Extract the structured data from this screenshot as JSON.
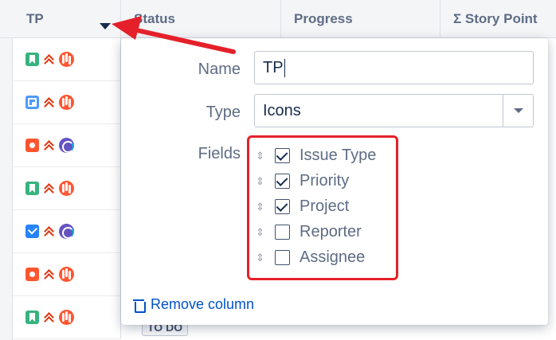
{
  "columns": {
    "tp": "TP",
    "status": "Status",
    "progress": "Progress",
    "story_points": "Σ Story Point"
  },
  "rows": [
    {
      "issue_type": "story-icon",
      "priority": "highest-priority-icon",
      "project": "red-project-icon"
    },
    {
      "issue_type": "subtask-icon",
      "priority": "highest-priority-icon",
      "project": "red-project-icon"
    },
    {
      "issue_type": "bug-icon",
      "priority": "highest-priority-icon",
      "project": "purple-project-icon"
    },
    {
      "issue_type": "story-icon",
      "priority": "highest-priority-icon",
      "project": "red-project-icon"
    },
    {
      "issue_type": "task-icon",
      "priority": "highest-priority-icon",
      "project": "purple-project-icon"
    },
    {
      "issue_type": "bug-icon",
      "priority": "highest-priority-icon",
      "project": "red-project-icon"
    },
    {
      "issue_type": "story-icon",
      "priority": "highest-priority-icon",
      "project": "red-project-icon"
    }
  ],
  "status_badge": "TO DO",
  "popup": {
    "name_label": "Name",
    "name_value": "TP",
    "type_label": "Type",
    "type_value": "Icons",
    "fields_label": "Fields",
    "fields": [
      {
        "label": "Issue Type",
        "checked": true
      },
      {
        "label": "Priority",
        "checked": true
      },
      {
        "label": "Project",
        "checked": true
      },
      {
        "label": "Reporter",
        "checked": false
      },
      {
        "label": "Assignee",
        "checked": false
      }
    ],
    "remove_column": "Remove column"
  },
  "colors": {
    "highlight_box": "#e5202a",
    "annotation_arrow": "#e5202a",
    "link": "#0052cc"
  }
}
